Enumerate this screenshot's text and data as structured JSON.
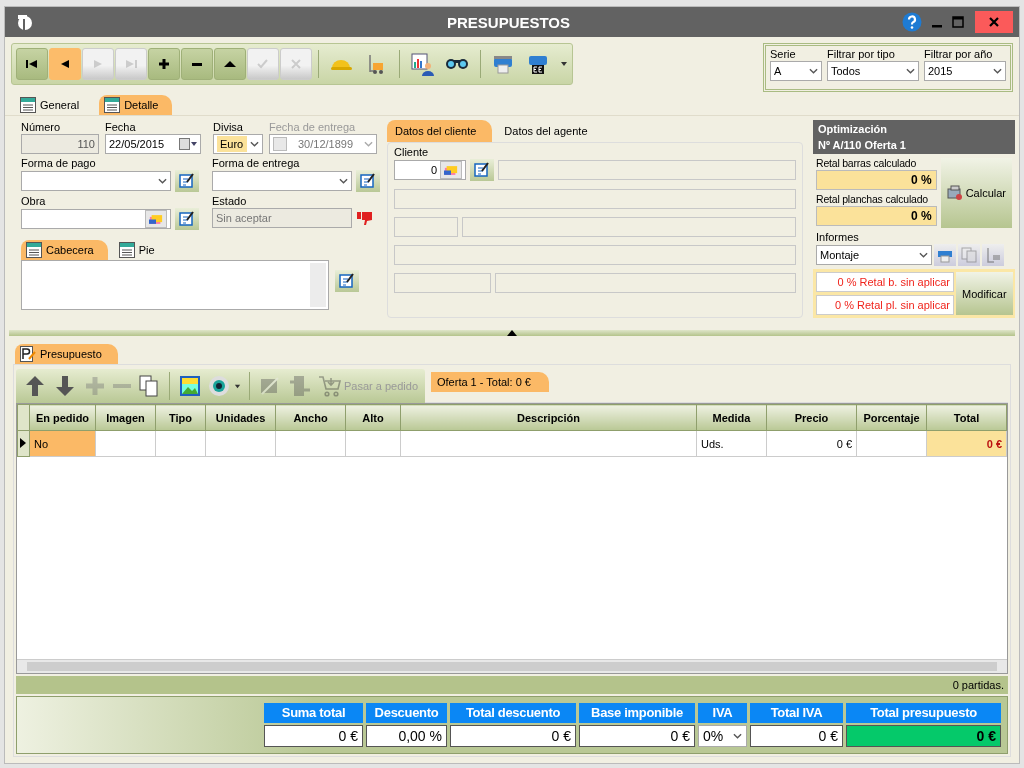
{
  "window": {
    "title": "PRESUPUESTOS"
  },
  "toolbar": [
    {
      "kind": "first",
      "selected": false,
      "disabled": false
    },
    {
      "kind": "prev",
      "selected": true,
      "disabled": false
    },
    {
      "kind": "next",
      "selected": false,
      "disabled": true
    },
    {
      "kind": "last",
      "selected": false,
      "disabled": true
    },
    {
      "kind": "add",
      "selected": false,
      "disabled": false
    },
    {
      "kind": "remove",
      "selected": false,
      "disabled": false
    },
    {
      "kind": "up",
      "selected": false,
      "disabled": false
    },
    {
      "kind": "check",
      "selected": false,
      "disabled": true
    },
    {
      "kind": "cancel",
      "selected": false,
      "disabled": true
    },
    {
      "kind": "helmet",
      "selected": false,
      "disabled": false
    },
    {
      "kind": "forklift",
      "selected": false,
      "disabled": false
    },
    {
      "kind": "report",
      "selected": false,
      "disabled": false
    },
    {
      "kind": "binoculars",
      "selected": false,
      "disabled": false
    },
    {
      "kind": "printer",
      "selected": false,
      "disabled": false
    },
    {
      "kind": "printer-ce",
      "selected": false,
      "disabled": false
    }
  ],
  "filters": [
    {
      "label": "Serie",
      "value": "A"
    },
    {
      "label": "Filtrar por tipo",
      "value": "Todos"
    },
    {
      "label": "Filtrar por año",
      "value": "2015"
    }
  ],
  "main_tabs": [
    {
      "label": "General",
      "selected": false
    },
    {
      "label": "Detalle",
      "selected": true
    }
  ],
  "detail": {
    "numero": {
      "label": "Número",
      "value": "110"
    },
    "fecha": {
      "label": "Fecha",
      "value": "22/05/2015"
    },
    "divisa": {
      "label": "Divisa",
      "value": "Euro"
    },
    "fecha_entrega": {
      "label": "Fecha de entrega",
      "value": "30/12/1899",
      "disabled": true
    },
    "forma_pago": {
      "label": "Forma de pago"
    },
    "forma_entrega": {
      "label": "Forma de entrega"
    },
    "obra": {
      "label": "Obra"
    },
    "estado": {
      "label": "Estado",
      "value": "Sin aceptar"
    }
  },
  "notes_tabs": [
    {
      "label": "Cabecera",
      "selected": true
    },
    {
      "label": "Pie",
      "selected": false
    }
  ],
  "client_tabs": [
    {
      "label": "Datos del cliente",
      "selected": true
    },
    {
      "label": "Datos del agente",
      "selected": false
    }
  ],
  "client": {
    "label": "Cliente",
    "value": "0"
  },
  "optimization": {
    "title": "Optimización",
    "subtitle": "Nº A/110 Oferta 1",
    "retal_barras": {
      "label": "Retal barras calculado",
      "value": "0 %"
    },
    "retal_planchas": {
      "label": "Retal planchas calculado",
      "value": "0 %"
    },
    "calcular": "Calcular",
    "informes": {
      "label": "Informes",
      "value": "Montaje"
    },
    "sin_aplicar": [
      "0 % Retal b. sin aplicar",
      "0 % Retal pl. sin aplicar"
    ],
    "modificar": "Modificar"
  },
  "section_tab": {
    "label": "Presupuesto",
    "selected": true
  },
  "grid_toolbar": [
    {
      "kind": "arrow-up",
      "disabled": false
    },
    {
      "kind": "arrow-down",
      "disabled": false
    },
    {
      "kind": "plus",
      "disabled": true
    },
    {
      "kind": "minus",
      "disabled": true
    },
    {
      "kind": "copy",
      "disabled": false
    },
    {
      "kind": "picture",
      "disabled": false
    },
    {
      "kind": "eye",
      "disabled": false
    },
    {
      "kind": "tools",
      "disabled": true
    },
    {
      "kind": "transfer",
      "disabled": true
    },
    {
      "kind": "cart",
      "disabled": true,
      "label": "Pasar a pedido"
    }
  ],
  "offer_tabs": [
    {
      "label": "Oferta 1 - Total: 0 €",
      "selected": true
    }
  ],
  "table": {
    "columns": [
      {
        "label": "En pedido",
        "highlight": false
      },
      {
        "label": "Imagen",
        "highlight": false
      },
      {
        "label": "Tipo",
        "highlight": false
      },
      {
        "label": "Unidades",
        "highlight": false
      },
      {
        "label": "Ancho",
        "highlight": false
      },
      {
        "label": "Alto",
        "highlight": false
      },
      {
        "label": "Descripción",
        "highlight": false
      },
      {
        "label": "Medida",
        "highlight": false
      },
      {
        "label": "Precio",
        "highlight": false
      },
      {
        "label": "Porcentaje",
        "highlight": false
      },
      {
        "label": "Total",
        "highlight": true
      }
    ],
    "rows": [
      {
        "selected": true,
        "cells": [
          {
            "text": "No"
          },
          {},
          {},
          {},
          {},
          {},
          {},
          {
            "text": "Uds."
          },
          {
            "text": "0 €"
          },
          {},
          {
            "text": "0 €"
          }
        ]
      }
    ]
  },
  "status": "0 partidas.",
  "totals": [
    {
      "label": "Suma total",
      "value": "0 €",
      "kind": "text"
    },
    {
      "label": "Descuento",
      "value": "0,00 %",
      "kind": "text"
    },
    {
      "label": "Total descuento",
      "value": "0 €",
      "kind": "text"
    },
    {
      "label": "Base imponible",
      "value": "0 €",
      "kind": "text"
    },
    {
      "label": "IVA",
      "value": "0%",
      "kind": "select"
    },
    {
      "label": "Total IVA",
      "value": "0 €",
      "kind": "text"
    },
    {
      "label": "Total presupuesto",
      "value": "0 €",
      "kind": "grand"
    }
  ]
}
